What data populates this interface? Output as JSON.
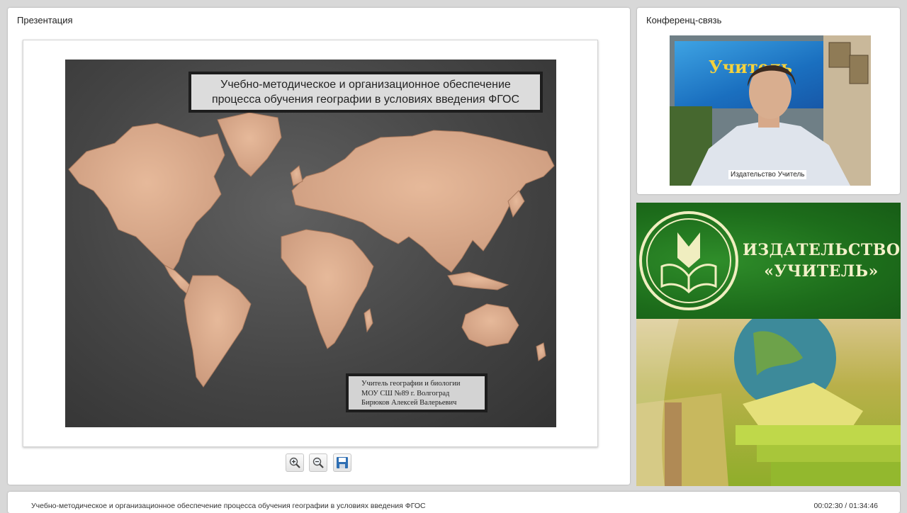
{
  "presentation": {
    "panel_title": "Презентация",
    "slide": {
      "title_line1": "Учебно-методическое и организационное обеспечение",
      "title_line2": "процесса обучения географии в условиях введения ФГОС",
      "author_line1": "Учитель географии и биологии",
      "author_line2": "МОУ СШ №89 г. Волгоград",
      "author_line3": "Бирюков Алексей Валерьевич"
    },
    "toolbar": {
      "zoom_in": "zoom-in-icon",
      "zoom_out": "zoom-out-icon",
      "save": "save-icon"
    }
  },
  "conference": {
    "panel_title": "Конференц-связь",
    "video_label": "Издательство Учитель",
    "poster_text": "Учитель"
  },
  "brand": {
    "line1": "ИЗДАТЕЛЬСТВО",
    "line2": "«УЧИТЕЛЬ»",
    "colors": {
      "green": "#1d6d1b",
      "cream": "#f3f1c9"
    }
  },
  "status_bar": {
    "caption": "Учебно-методическое и организационное обеспечение процесса обучения географии в условиях введения ФГОС",
    "timecode": "00:02:30 / 01:34:46"
  }
}
